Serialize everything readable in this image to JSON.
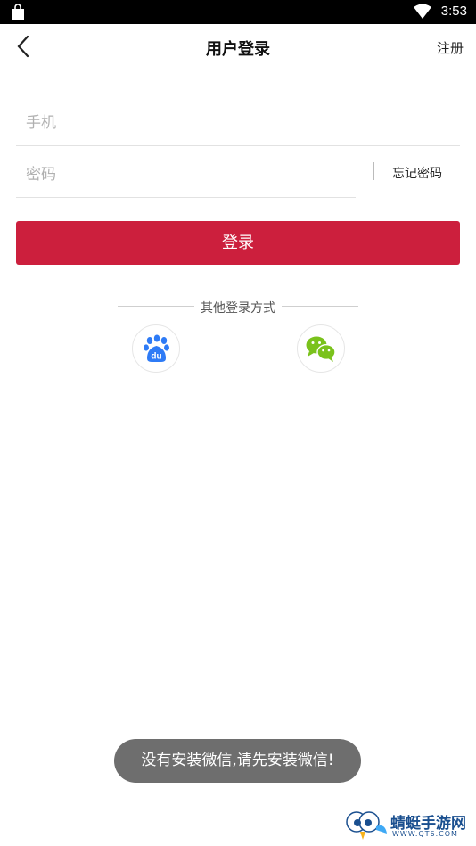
{
  "status_bar": {
    "time": "3:53"
  },
  "header": {
    "title": "用户登录",
    "register_label": "注册"
  },
  "form": {
    "phone_placeholder": "手机",
    "password_placeholder": "密码",
    "forgot_label": "忘记密码",
    "login_label": "登录"
  },
  "other_login": {
    "title": "其他登录方式",
    "providers": [
      "baidu-icon",
      "wechat-icon"
    ]
  },
  "toast": {
    "message": "没有安装微信,请先安装微信!"
  },
  "watermark": {
    "brand": "蜻蜓手游网",
    "site": "WWW.QT6.COM"
  },
  "colors": {
    "accent": "#cc1f3d",
    "baidu": "#2e7bf6",
    "wechat": "#7ac21c"
  }
}
